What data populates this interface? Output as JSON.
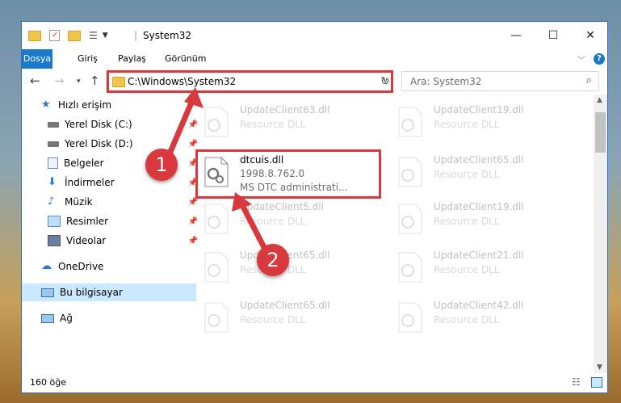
{
  "window": {
    "title": "System32",
    "controls": {
      "minimize": "—",
      "maximize": "☐",
      "close": "✕"
    }
  },
  "ribbon": {
    "tabs": [
      {
        "label": "Dosya",
        "active": true
      },
      {
        "label": "Giriş"
      },
      {
        "label": "Paylaş"
      },
      {
        "label": "Görünüm"
      }
    ],
    "help": "?"
  },
  "navigation": {
    "address": "C:\\Windows\\System32",
    "search_placeholder": "Ara: System32"
  },
  "sidebar": {
    "items": [
      {
        "label": "Hızlı erişim",
        "icon": "star-icon"
      },
      {
        "label": "Yerel Disk (C:)",
        "icon": "drive-icon",
        "pinned": true
      },
      {
        "label": "Yerel Disk (D:)",
        "icon": "drive-icon",
        "pinned": true
      },
      {
        "label": "Belgeler",
        "icon": "documents-icon",
        "pinned": true
      },
      {
        "label": "İndirmeler",
        "icon": "download-icon",
        "pinned": true
      },
      {
        "label": "Müzik",
        "icon": "music-icon",
        "pinned": true
      },
      {
        "label": "Resimler",
        "icon": "pictures-icon",
        "pinned": true
      },
      {
        "label": "Videolar",
        "icon": "videos-icon",
        "pinned": true
      },
      {
        "label": "OneDrive",
        "icon": "cloud-icon"
      },
      {
        "label": "Bu bilgisayar",
        "icon": "computer-icon",
        "selected": true
      },
      {
        "label": "Ağ",
        "icon": "network-icon"
      }
    ]
  },
  "files": [
    {
      "name": "UpdateClient63.dll",
      "sub": "Resource DLL"
    },
    {
      "name": "UpdateClient19.dll",
      "sub": "Resource DLL"
    },
    {
      "name": "dtcuis.dll",
      "version": "1998.8.762.0",
      "description": "MS DTC administrati..."
    },
    {
      "name": "UpdateClient65.dll",
      "sub": "Resource DLL"
    },
    {
      "name": "UpdateClient5.dll",
      "sub": "Resource DLL"
    },
    {
      "name": "UpdateClient19.dll",
      "sub": "Resource DLL"
    },
    {
      "name": "UpdateClient65.dll",
      "sub": "Resource DLL"
    },
    {
      "name": "UpdateClient21.dll",
      "sub": "Resource DLL"
    },
    {
      "name": "UpdateClient65.dll",
      "sub": "Resource DLL"
    },
    {
      "name": "UpdateClient42.dll",
      "sub": "Resource DLL"
    }
  ],
  "status": {
    "item_count": "160 öğe"
  },
  "annotations": [
    {
      "number": "1"
    },
    {
      "number": "2"
    }
  ],
  "colors": {
    "accent": "#1979ca",
    "highlight": "#d9393d",
    "selected": "#cce8ff"
  }
}
